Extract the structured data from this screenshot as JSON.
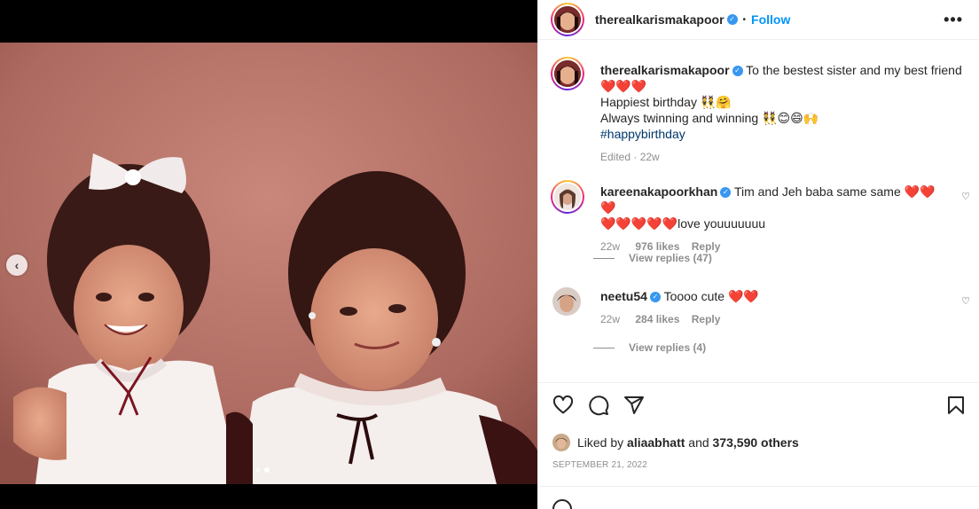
{
  "post": {
    "username": "therealkarismakapoor",
    "separator": "•",
    "follow_label": "Follow",
    "more_label": "•••"
  },
  "caption": {
    "username": "therealkarismakapoor",
    "line1": "To the bestest sister and my best friend",
    "line2_hearts": "❤️❤️❤️",
    "line3": "Happiest birthday 👯🤗",
    "line4": "Always twinning and winning 👯😊😄🙌",
    "hashtag": "#happybirthday",
    "edited": "Edited · 22w"
  },
  "comments": [
    {
      "username": "kareenakapoorkhan",
      "text_a": "Tim and Jeh baba same same ❤️❤️❤️",
      "text_b": "❤️❤️❤️❤️❤️love youuuuuuu",
      "age": "22w",
      "likes": "976 likes",
      "reply": "Reply",
      "view_replies": "View replies (47)"
    },
    {
      "username": "neetu54",
      "text_a": "Toooo cute ❤️❤️",
      "age": "22w",
      "likes": "284 likes",
      "reply": "Reply",
      "view_replies": "View replies (4)"
    }
  ],
  "likes": {
    "prefix": "Liked by",
    "user": "aliaabhatt",
    "and": "and",
    "others": "373,590 others"
  },
  "date": "SEPTEMBER 21, 2022",
  "icons": {
    "like": "heart-icon",
    "comment": "comment-icon",
    "share": "paper-plane-icon",
    "save": "bookmark-icon",
    "prev": "chevron-left-icon"
  },
  "colors": {
    "link": "#0095f6",
    "verified": "#3897f0",
    "hashtag": "#00376b",
    "heart": "#e0141e"
  }
}
